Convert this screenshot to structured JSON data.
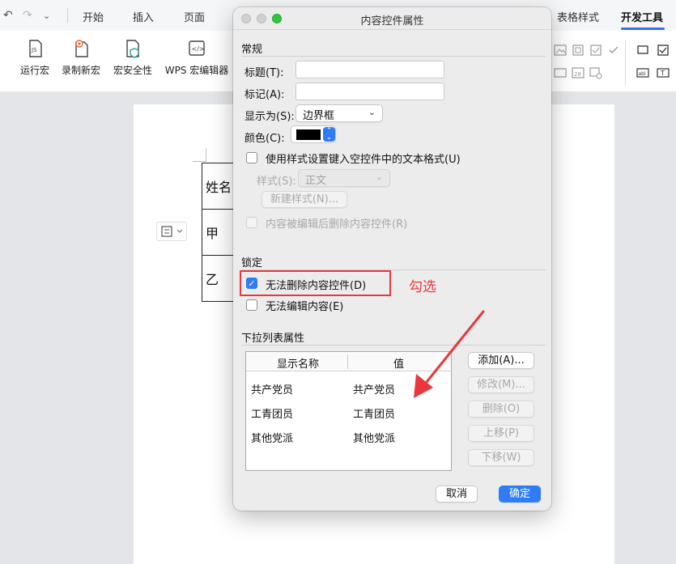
{
  "ribbon": {
    "tabs": [
      {
        "label": "开始"
      },
      {
        "label": "插入"
      },
      {
        "label": "页面"
      },
      {
        "label": "表格样式"
      },
      {
        "label": "开发工具"
      }
    ],
    "tools": [
      {
        "label": "运行宏"
      },
      {
        "label": "录制新宏"
      },
      {
        "label": "宏安全性"
      },
      {
        "label": "WPS 宏编辑器"
      }
    ],
    "tool_icons": [
      "run-macro-icon",
      "record-macro-icon",
      "macro-security-icon",
      "wps-macro-editor-icon"
    ]
  },
  "document": {
    "table_rows": [
      "姓名",
      "甲",
      "乙"
    ]
  },
  "dialog": {
    "title": "内容控件属性",
    "general": {
      "section": "常规",
      "title_label": "标题(T):",
      "title_value": "",
      "tag_label": "标记(A):",
      "tag_value": "",
      "show_as_label": "显示为(S):",
      "show_as_value": "边界框",
      "color_label": "颜色(C):",
      "color_value": "#000000",
      "use_style_label": "使用样式设置键入空控件中的文本格式(U)",
      "style_label": "样式(S):",
      "style_value": "正文",
      "new_style_label": "新建样式(N)...",
      "remove_after_edit_label": "内容被编辑后删除内容控件(R)"
    },
    "lock": {
      "section": "锁定",
      "cannot_delete_label": "无法删除内容控件(D)",
      "cannot_delete_checked": true,
      "cannot_edit_label": "无法编辑内容(E)",
      "cannot_edit_checked": false
    },
    "dropdown": {
      "section": "下拉列表属性",
      "col_display": "显示名称",
      "col_value": "值",
      "items": [
        {
          "display": "共产党员",
          "value": "共产党员"
        },
        {
          "display": "工青团员",
          "value": "工青团员"
        },
        {
          "display": "其他党派",
          "value": "其他党派"
        }
      ],
      "add_label": "添加(A)...",
      "modify_label": "修改(M)...",
      "delete_label": "删除(O)",
      "up_label": "上移(P)",
      "down_label": "下移(W)"
    },
    "cancel_label": "取消",
    "ok_label": "确定"
  },
  "annotation": {
    "text": "勾选",
    "color": "#e8383d"
  },
  "colors": {
    "accent": "#2f7cf6",
    "tab_underline": "#3a6fe8",
    "annotation": "#e8383d"
  }
}
